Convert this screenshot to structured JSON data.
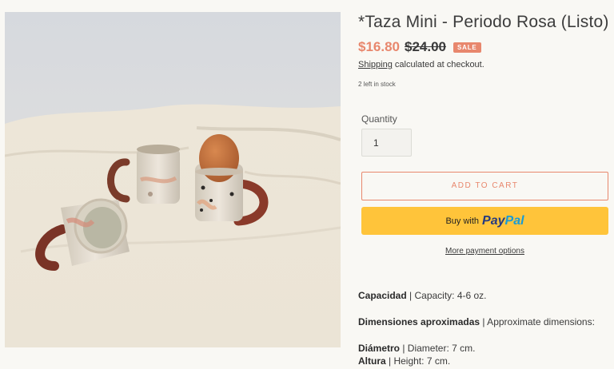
{
  "product": {
    "title": "*Taza Mini - Periodo Rosa (Listo)",
    "price_sale": "$16.80",
    "price_compare": "$24.00",
    "badge": "SALE",
    "shipping_link": "Shipping",
    "shipping_text": " calculated at checkout.",
    "stock": "2 left in stock"
  },
  "quantity": {
    "label": "Quantity",
    "value": "1"
  },
  "buttons": {
    "add_to_cart": "ADD TO CART",
    "paypal_prefix": "Buy with",
    "paypal_logo_1": "Pay",
    "paypal_logo_2": "Pal",
    "more_payment": "More payment options"
  },
  "specs": {
    "capacity_label": "Capacidad",
    "capacity_text": " | Capacity: 4-6 oz.",
    "dimensions_label": "Dimensiones aproximadas",
    "dimensions_text": " | Approximate dimensions:",
    "diameter_label": "Diámetro",
    "diameter_text": " | Diameter: 7 cm.",
    "height_label": "Altura",
    "height_text": " | Height:  7 cm."
  },
  "colors": {
    "accent": "#e8876d",
    "paypal_yellow": "#ffc43a",
    "background": "#f9f8f4"
  }
}
